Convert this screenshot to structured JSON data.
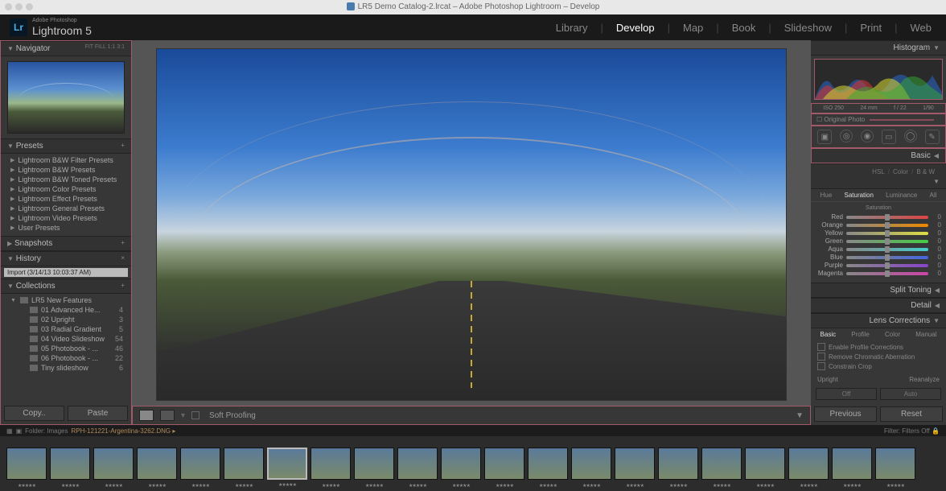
{
  "titlebar": "LR5 Demo Catalog-2.lrcat – Adobe Photoshop Lightroom – Develop",
  "brand": {
    "code": "Lr",
    "sub": "Adobe Photoshop",
    "name": "Lightroom 5"
  },
  "modules": [
    "Library",
    "Develop",
    "Map",
    "Book",
    "Slideshow",
    "Print",
    "Web"
  ],
  "active_module": "Develop",
  "navigator": {
    "title": "Navigator",
    "opts": "FIT  FILL  1:1  3:1"
  },
  "presets": {
    "title": "Presets",
    "items": [
      "Lightroom B&W Filter Presets",
      "Lightroom B&W Presets",
      "Lightroom B&W Toned Presets",
      "Lightroom Color Presets",
      "Lightroom Effect Presets",
      "Lightroom General Presets",
      "Lightroom Video Presets",
      "User Presets"
    ]
  },
  "snapshots": "Snapshots",
  "history": {
    "title": "History",
    "entry": "Import (3/14/13 10:03:37 AM)"
  },
  "collections": {
    "title": "Collections",
    "parent": "LR5 New Features",
    "items": [
      {
        "name": "01 Advanced He...",
        "count": "4"
      },
      {
        "name": "02 Upright",
        "count": "3"
      },
      {
        "name": "03 Radial Gradient",
        "count": "5"
      },
      {
        "name": "04 Video Slideshow",
        "count": "54"
      },
      {
        "name": "05 Photobook - ...",
        "count": "46"
      },
      {
        "name": "06 Photobook - ...",
        "count": "22"
      },
      {
        "name": "Tiny slideshow",
        "count": "6"
      }
    ]
  },
  "left_buttons": {
    "copy": "Copy..",
    "paste": "Paste"
  },
  "soft_proof": "Soft Proofing",
  "histogram": {
    "title": "Histogram",
    "info": [
      "ISO 250",
      "24 mm",
      "f / 22",
      "1/90"
    ],
    "orig": "☐ Original Photo"
  },
  "basic": "Basic",
  "hsl": {
    "tabs": [
      "HSL",
      "Color",
      "B & W"
    ],
    "subtabs": [
      "Hue",
      "Saturation",
      "Luminance",
      "All"
    ],
    "active_sub": "Saturation",
    "label": "Saturation",
    "sliders": [
      {
        "name": "Red",
        "grad": "linear-gradient(to right,#888,#d44)",
        "val": "0"
      },
      {
        "name": "Orange",
        "grad": "linear-gradient(to right,#888,#e80)",
        "val": "0"
      },
      {
        "name": "Yellow",
        "grad": "linear-gradient(to right,#888,#dd4)",
        "val": "0"
      },
      {
        "name": "Green",
        "grad": "linear-gradient(to right,#888,#4c4)",
        "val": "0"
      },
      {
        "name": "Aqua",
        "grad": "linear-gradient(to right,#888,#4cc)",
        "val": "0"
      },
      {
        "name": "Blue",
        "grad": "linear-gradient(to right,#888,#46d)",
        "val": "0"
      },
      {
        "name": "Purple",
        "grad": "linear-gradient(to right,#888,#84c)",
        "val": "0"
      },
      {
        "name": "Magenta",
        "grad": "linear-gradient(to right,#888,#c4a)",
        "val": "0"
      }
    ]
  },
  "split": "Split Toning",
  "detail": "Detail",
  "lens": {
    "title": "Lens Corrections",
    "tabs": [
      "Basic",
      "Profile",
      "Color",
      "Manual"
    ],
    "active": "Basic",
    "checks": [
      "Enable Profile Corrections",
      "Remove Chromatic Aberration",
      "Constrain Crop"
    ],
    "upright": "Upright",
    "reanalyze": "Reanalyze",
    "off": "Off",
    "auto": "Auto"
  },
  "right_buttons": {
    "prev": "Previous",
    "reset": "Reset"
  },
  "filmstrip_bar": {
    "folder": "Folder: Images",
    "breadcrumb": "RPH-121221-Argentina-3262.DNG ▸",
    "filter": "Filter:",
    "filters_off": "Filters Off"
  },
  "thumb_count": 21
}
